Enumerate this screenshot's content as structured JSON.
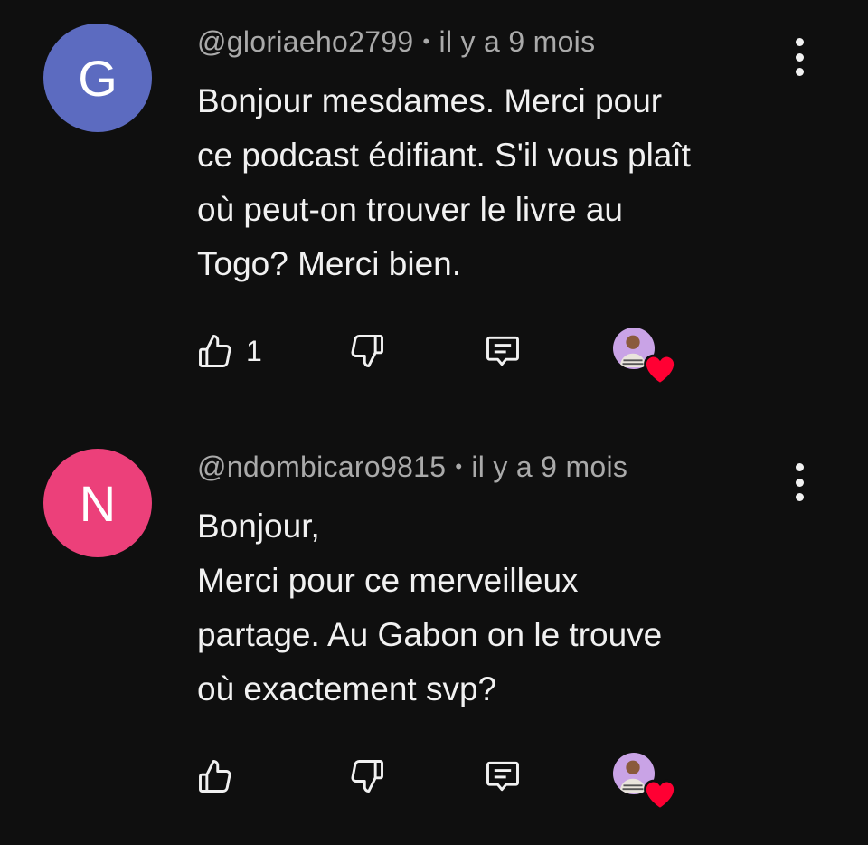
{
  "comments": [
    {
      "avatar_letter": "G",
      "avatar_color": "#5c6bc0",
      "handle": "@gloriaeho2799",
      "separator": "•",
      "time": "il y a 9 mois",
      "text": "Bonjour mesdames. Merci pour\nce podcast édifiant. S'il vous plaît\noù peut-on trouver le livre au\nTogo? Merci bien.",
      "like_count": "1"
    },
    {
      "avatar_letter": "N",
      "avatar_color": "#ec407a",
      "handle": "@ndombicaro9815",
      "separator": "•",
      "time": "il y a 9 mois",
      "text": "Bonjour,\nMerci pour ce merveilleux\npartage. Au Gabon on le trouve\noù exactement svp?",
      "like_count": ""
    }
  ],
  "icons": {
    "like": "thumb-up-icon",
    "dislike": "thumb-down-icon",
    "reply": "comment-icon",
    "menu": "more-vert-icon",
    "creator_heart": "heart-icon"
  },
  "colors": {
    "background": "#0f0f0f",
    "text": "#f1f1f1",
    "meta": "#aaaaaa",
    "heart": "#ff0033"
  }
}
